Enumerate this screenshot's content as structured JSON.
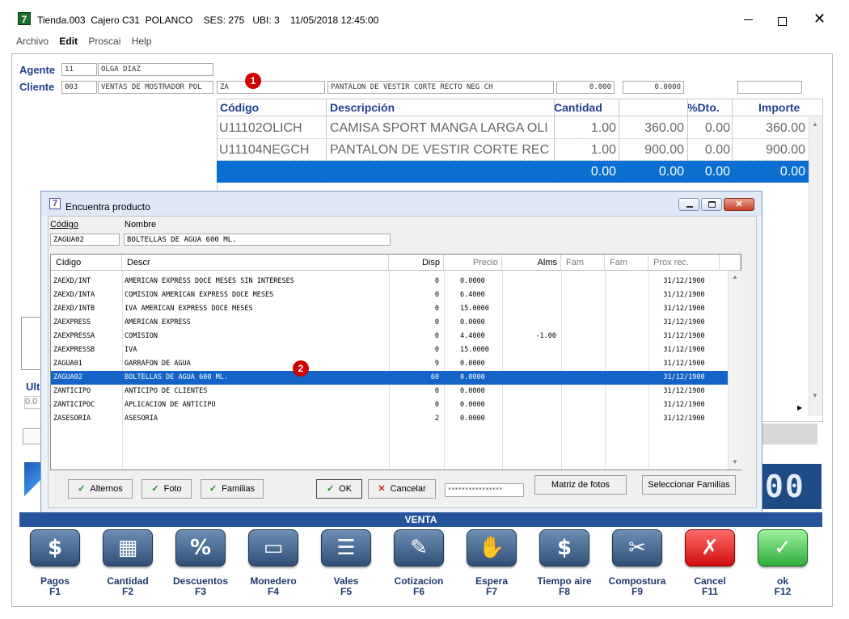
{
  "window": {
    "title": "Tienda.003  Cajero C31  POLANCO    SES: 275   UBI: 3    11/05/2018 12:45:00",
    "menu": [
      "Archivo",
      "Edit",
      "Proscai",
      "Help"
    ],
    "app_icon": "7"
  },
  "header": {
    "agente_label": "Agente",
    "agente_code": "11",
    "agente_name": "OLGA DIAZ",
    "cliente_label": "Cliente",
    "cliente_code": "003",
    "cliente_name": "VENTAS DE MOSTRADOR POL",
    "product_input": "ZA",
    "product_desc": "PANTALON DE VESTIR CORTE RECTO NEG CH",
    "qty_value": "0.000",
    "price_value": "0.0000",
    "badge1": "1"
  },
  "grid": {
    "columns": [
      "Código",
      "Descripción",
      "Cantidad",
      "",
      "%Dto.",
      "Importe"
    ],
    "rows": [
      {
        "codigo": "U11102OLICH",
        "desc": "CAMISA SPORT MANGA LARGA OLI",
        "cantidad": "1.00",
        "precio": "360.00",
        "dto": "0.00",
        "importe": "360.00"
      },
      {
        "codigo": "U11104NEGCH",
        "desc": "PANTALON DE VESTIR CORTE REC",
        "cantidad": "1.00",
        "precio": "900.00",
        "dto": "0.00",
        "importe": "900.00"
      },
      {
        "codigo": "",
        "desc": "",
        "cantidad": "0.00",
        "precio": "0.00",
        "dto": "0.00",
        "importe": "0.00"
      }
    ]
  },
  "side_fragments": {
    "ult_label": "Ult",
    "ult_value": "0.0",
    "digits": "00"
  },
  "dialog": {
    "title": "Encuentra producto",
    "codigo_label": "Código",
    "nombre_label": "Nombre",
    "codigo_value": "ZAGUA02",
    "nombre_value": "BOLTELLAS DE AGUA 600 ML.",
    "columns": [
      "Cidigo",
      "Descr",
      "Disp",
      "Precio",
      "Alms",
      "Fam",
      "Fam",
      "Prox rec."
    ],
    "rows": [
      {
        "code": "ZAEXD/INT",
        "descr": "AMERICAN EXPRESS DOCE MESES SIN INTERESES",
        "disp": "0",
        "precio": "0.0000",
        "alms": "",
        "fecha": "31/12/1900"
      },
      {
        "code": "ZAEXD/INTA",
        "descr": "COMISION AMERICAN EXPRESS DOCE MESES",
        "disp": "0",
        "precio": "6.4000",
        "alms": "",
        "fecha": "31/12/1900"
      },
      {
        "code": "ZAEXD/INTB",
        "descr": "IVA AMERICAN EXPRESS DOCE MESES",
        "disp": "0",
        "precio": "15.0000",
        "alms": "",
        "fecha": "31/12/1900"
      },
      {
        "code": "ZAEXPRESS",
        "descr": "AMERICAN EXPRESS",
        "disp": "0",
        "precio": "0.0000",
        "alms": "",
        "fecha": "31/12/1900"
      },
      {
        "code": "ZAEXPRESSA",
        "descr": "COMISION",
        "disp": "0",
        "precio": "4.4000",
        "alms": "-1.00",
        "fecha": "31/12/1900"
      },
      {
        "code": "ZAEXPRESSB",
        "descr": "IVA",
        "disp": "0",
        "precio": "15.0000",
        "alms": "",
        "fecha": "31/12/1900"
      },
      {
        "code": "ZAGUA01",
        "descr": "GARRAFON DE AGUA",
        "disp": "9",
        "precio": "0.0000",
        "alms": "",
        "fecha": "31/12/1900"
      },
      {
        "code": "ZAGUA02",
        "descr": "BOLTELLAS DE AGUA 600 ML.",
        "disp": "60",
        "precio": "0.0000",
        "alms": "",
        "fecha": "31/12/1900"
      },
      {
        "code": "ZANTICIPO",
        "descr": "ANTICIPO DE CLIENTES",
        "disp": "0",
        "precio": "0.0000",
        "alms": "",
        "fecha": "31/12/1900"
      },
      {
        "code": "ZANTICIPOC",
        "descr": "APLICACION DE ANTICIPO",
        "disp": "0",
        "precio": "0.0000",
        "alms": "",
        "fecha": "31/12/1900"
      },
      {
        "code": "ZASESORIA",
        "descr": "ASESORIA",
        "disp": "2",
        "precio": "0.0000",
        "alms": "",
        "fecha": "31/12/1900"
      }
    ],
    "selected_index": 7,
    "badge2": "2",
    "buttons": {
      "alternos": "Alternos",
      "foto": "Foto",
      "familias": "Familias",
      "ok": "OK",
      "cancelar": "Cancelar",
      "password": "****************",
      "matriz": "Matriz de fotos",
      "seleccionar": "Seleccionar Familias"
    }
  },
  "venta_bar": "VENTA",
  "toolbar": [
    {
      "label": "Pagos",
      "key": "F1",
      "icon": "cash-icon",
      "color": "blue"
    },
    {
      "label": "Cantidad",
      "key": "F2",
      "icon": "calculator-icon",
      "color": "blue"
    },
    {
      "label": "Descuentos",
      "key": "F3",
      "icon": "percent-icon",
      "color": "blue"
    },
    {
      "label": "Monedero",
      "key": "F4",
      "icon": "card-icon",
      "color": "blue"
    },
    {
      "label": "Vales",
      "key": "F5",
      "icon": "voucher-icon",
      "color": "blue"
    },
    {
      "label": "Cotizacion",
      "key": "F6",
      "icon": "quote-icon",
      "color": "blue"
    },
    {
      "label": "Espera",
      "key": "F7",
      "icon": "hand-icon",
      "color": "blue"
    },
    {
      "label": "Tiempo aire",
      "key": "F8",
      "icon": "phone-icon",
      "color": "blue"
    },
    {
      "label": "Compostura",
      "key": "F9",
      "icon": "scissors-icon",
      "color": "blue"
    },
    {
      "label": "Cancel",
      "key": "F11",
      "icon": "x-icon",
      "color": "red"
    },
    {
      "label": "ok",
      "key": "F12",
      "icon": "check-icon",
      "color": "green"
    }
  ]
}
